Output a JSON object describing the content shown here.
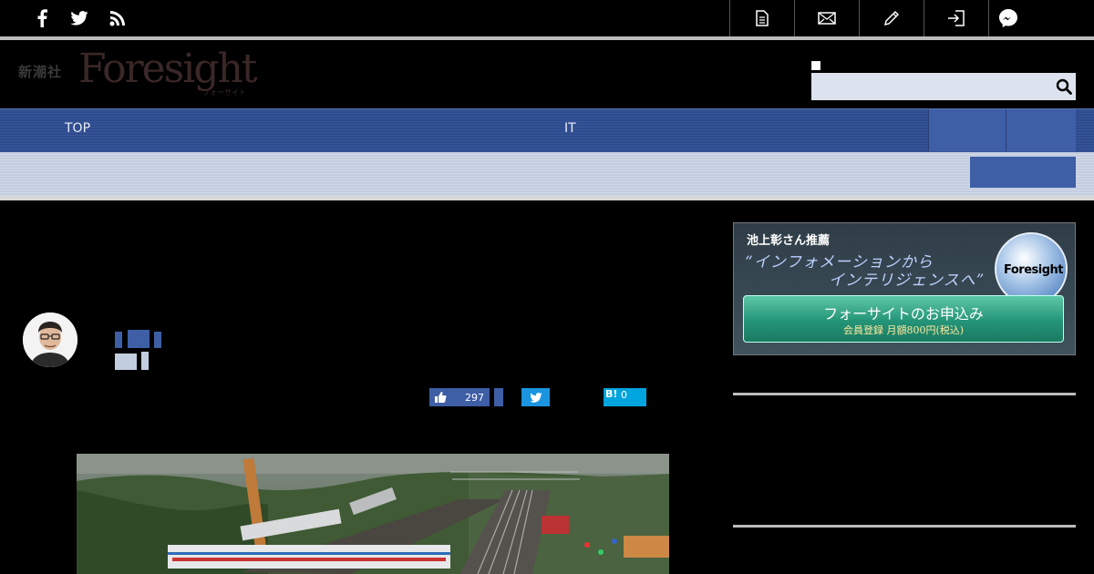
{
  "header": {
    "logo_kanji": "新潮社",
    "logo_main": "Foresight",
    "logo_sub": "フォーサイト",
    "search_placeholder": ""
  },
  "nav": {
    "items": [
      {
        "label": "TOP"
      },
      {
        "label": "IT"
      }
    ]
  },
  "share": {
    "like_count": "297",
    "hatena_label": "B!",
    "hatena_count": "0"
  },
  "banner": {
    "small": "池上彰さん推薦",
    "line1": "“インフォメーションから",
    "line2": "インテリジェンスへ”",
    "globe_text": "Foresight",
    "cta_main": "フォーサイトのお申込み",
    "cta_sub": "会員登録 月額800円(税込)"
  },
  "colors": {
    "nav_blue": "#2d4b8f",
    "accent_blue": "#3e5ea6",
    "twitter": "#1b95e0",
    "hatena": "#00a4de",
    "cta_green": "#249478"
  }
}
